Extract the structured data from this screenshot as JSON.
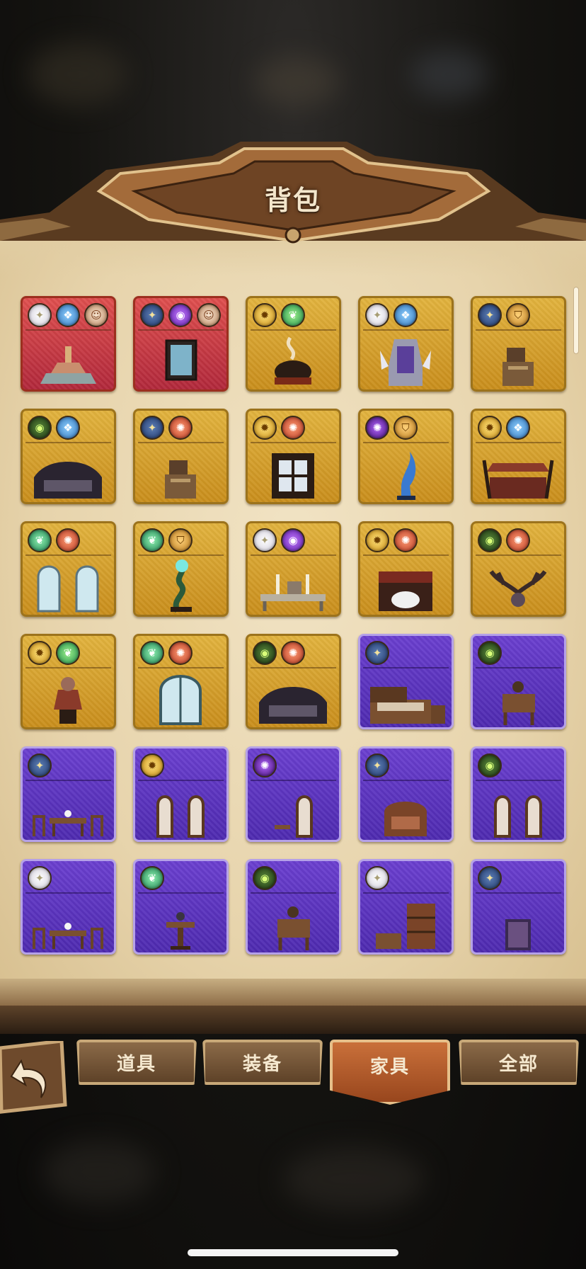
{
  "header": {
    "title": "背包"
  },
  "tabs": [
    {
      "label": "道具",
      "active": false
    },
    {
      "label": "装备",
      "active": false
    },
    {
      "label": "家具",
      "active": true
    },
    {
      "label": "全部",
      "active": false
    }
  ],
  "colors": {
    "gold_tile": "#d9a02c",
    "red_tile": "#c93a45",
    "purple_tile": "#5c33c0",
    "parchment": "#ead9b4",
    "active_tab": "#b55a2a"
  },
  "items": [
    {
      "rarity": "red",
      "badges": [
        "white",
        "blue",
        "portrait"
      ],
      "icon": "fountain-icon"
    },
    {
      "rarity": "red",
      "badges": [
        "star",
        "violet",
        "portrait"
      ],
      "icon": "painting-icon"
    },
    {
      "rarity": "gold",
      "badges": [
        "yellow",
        "green"
      ],
      "icon": "cauldron-icon"
    },
    {
      "rarity": "gold",
      "badges": [
        "white",
        "blue"
      ],
      "icon": "throne-icon"
    },
    {
      "rarity": "gold",
      "badges": [
        "star",
        "shield"
      ],
      "icon": "desk-icon"
    },
    {
      "rarity": "gold",
      "badges": [
        "eye",
        "blue"
      ],
      "icon": "sofa-icon"
    },
    {
      "rarity": "gold",
      "badges": [
        "star",
        "orange"
      ],
      "icon": "desk-icon"
    },
    {
      "rarity": "gold",
      "badges": [
        "yellow",
        "orange"
      ],
      "icon": "gate-icon"
    },
    {
      "rarity": "gold",
      "badges": [
        "spiral",
        "shield"
      ],
      "icon": "statue-icon"
    },
    {
      "rarity": "gold",
      "badges": [
        "yellow",
        "blue"
      ],
      "icon": "canopy-bed-icon"
    },
    {
      "rarity": "gold",
      "badges": [
        "leaf",
        "orange"
      ],
      "icon": "arched-windows-icon"
    },
    {
      "rarity": "gold",
      "badges": [
        "leaf",
        "shield"
      ],
      "icon": "serpent-lamp-icon"
    },
    {
      "rarity": "gold",
      "badges": [
        "white",
        "violet"
      ],
      "icon": "candle-table-icon"
    },
    {
      "rarity": "gold",
      "badges": [
        "yellow",
        "orange"
      ],
      "icon": "fireplace-icon"
    },
    {
      "rarity": "gold",
      "badges": [
        "eye",
        "orange"
      ],
      "icon": "antlers-icon"
    },
    {
      "rarity": "gold",
      "badges": [
        "yellow",
        "green"
      ],
      "icon": "bust-icon"
    },
    {
      "rarity": "gold",
      "badges": [
        "leaf",
        "orange"
      ],
      "icon": "arched-window-icon"
    },
    {
      "rarity": "gold",
      "badges": [
        "eye",
        "orange"
      ],
      "icon": "sofa-icon"
    },
    {
      "rarity": "purple",
      "badges": [
        "star"
      ],
      "icon": "bed-icon"
    },
    {
      "rarity": "purple",
      "badges": [
        "eye"
      ],
      "icon": "side-table-icon"
    },
    {
      "rarity": "purple",
      "badges": [
        "star"
      ],
      "icon": "dining-set-icon"
    },
    {
      "rarity": "purple",
      "badges": [
        "yellow"
      ],
      "icon": "windows-icon"
    },
    {
      "rarity": "purple",
      "badges": [
        "spiral"
      ],
      "icon": "window-icon"
    },
    {
      "rarity": "purple",
      "badges": [
        "star"
      ],
      "icon": "armchair-icon"
    },
    {
      "rarity": "purple",
      "badges": [
        "eye"
      ],
      "icon": "windows-icon"
    },
    {
      "rarity": "purple",
      "badges": [
        "white"
      ],
      "icon": "dining-set-icon"
    },
    {
      "rarity": "purple",
      "badges": [
        "leaf"
      ],
      "icon": "pedestal-icon"
    },
    {
      "rarity": "purple",
      "badges": [
        "eye"
      ],
      "icon": "side-table-icon"
    },
    {
      "rarity": "purple",
      "badges": [
        "white"
      ],
      "icon": "bookshelf-icon"
    },
    {
      "rarity": "purple",
      "badges": [
        "star"
      ],
      "icon": "mirror-icon"
    }
  ]
}
